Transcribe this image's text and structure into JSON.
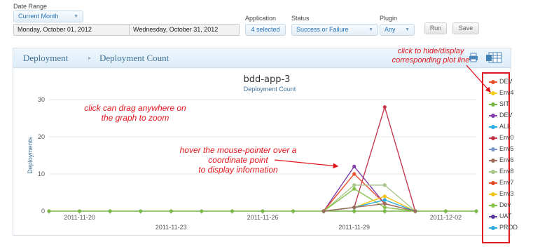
{
  "filters": {
    "date_range_label": "Date Range",
    "date_range_value": "Current Month",
    "start_date": "Monday, October 01, 2012",
    "end_date": "Wednesday, October 31, 2012",
    "application_label": "Application",
    "application_value": "4 selected",
    "status_label": "Status",
    "status_value": "Success or Failure",
    "plugin_label": "Plugin",
    "plugin_value": "Any",
    "run_label": "Run",
    "save_label": "Save"
  },
  "panel": {
    "breadcrumb_1": "Deployment",
    "breadcrumb_sep": "▸",
    "breadcrumb_2": "Deployment Count"
  },
  "annotations": {
    "legend_hint_1": "click to hide/display",
    "legend_hint_2": "corresponding plot line",
    "zoom_hint_1": "click can drag anywhere on",
    "zoom_hint_2": "the graph to zoom",
    "hover_hint_1": "hover the mouse-pointer over a",
    "hover_hint_2": "coordinate point",
    "hover_hint_3": "to display information"
  },
  "legend": [
    {
      "name": "DEV",
      "color": "#e8502f"
    },
    {
      "name": "Env4",
      "color": "#f4cf1a"
    },
    {
      "name": "SIT",
      "color": "#7ab648"
    },
    {
      "name": "DEV",
      "color": "#7f3fa8"
    },
    {
      "name": "ALL",
      "color": "#2eaee2"
    },
    {
      "name": "Env0",
      "color": "#c23a4e"
    },
    {
      "name": "Env5",
      "color": "#7d97c8"
    },
    {
      "name": "Env6",
      "color": "#9c6f5c"
    },
    {
      "name": "Env8",
      "color": "#a7c58a"
    },
    {
      "name": "Env7",
      "color": "#e14b26"
    },
    {
      "name": "Env3",
      "color": "#f2c21d"
    },
    {
      "name": "Dev",
      "color": "#85c24a"
    },
    {
      "name": "UAT",
      "color": "#5a3a9e"
    },
    {
      "name": "PROD",
      "color": "#33a9dd"
    }
  ],
  "chart_data": {
    "type": "line",
    "title": "bdd-app-3",
    "subtitle": "Deployment Count",
    "ylabel": "Deployments",
    "xlabel": "",
    "ylim": [
      0,
      30
    ],
    "yticks": [
      0,
      10,
      20,
      30
    ],
    "xticks_upper": [
      "2011-11-20",
      "2011-11-26",
      "2011-12-02"
    ],
    "xticks_lower": [
      "2011-11-23",
      "2011-11-29"
    ],
    "x": [
      "2011-11-19",
      "2011-11-20",
      "2011-11-21",
      "2011-11-22",
      "2011-11-23",
      "2011-11-24",
      "2011-11-25",
      "2011-11-26",
      "2011-11-27",
      "2011-11-28",
      "2011-11-29",
      "2011-11-30",
      "2011-12-01",
      "2011-12-02",
      "2011-12-03"
    ],
    "series": [
      {
        "name": "SIT",
        "color": "#7ab648",
        "values": [
          0,
          0,
          0,
          0,
          0,
          0,
          0,
          0,
          0,
          0,
          0,
          0,
          0,
          0,
          0
        ]
      },
      {
        "name": "Env0",
        "color": "#c23a4e",
        "values": [
          null,
          null,
          null,
          null,
          null,
          null,
          null,
          null,
          null,
          0,
          1,
          28,
          0,
          null,
          null
        ]
      },
      {
        "name": "DEV",
        "color": "#7f3fa8",
        "values": [
          null,
          null,
          null,
          null,
          null,
          null,
          null,
          null,
          null,
          0,
          12,
          2,
          0,
          null,
          null
        ]
      },
      {
        "name": "DEV",
        "color": "#e8502f",
        "values": [
          null,
          null,
          null,
          null,
          null,
          null,
          null,
          null,
          null,
          0,
          10,
          2,
          0,
          null,
          null
        ]
      },
      {
        "name": "Env8",
        "color": "#a7c58a",
        "values": [
          null,
          null,
          null,
          null,
          null,
          null,
          null,
          null,
          null,
          0,
          7,
          7,
          0,
          null,
          null
        ]
      },
      {
        "name": "Dev",
        "color": "#85c24a",
        "values": [
          null,
          null,
          null,
          null,
          null,
          null,
          null,
          null,
          null,
          0,
          6,
          1,
          0,
          null,
          null
        ]
      },
      {
        "name": "Env3",
        "color": "#f2c21d",
        "values": [
          null,
          null,
          null,
          null,
          null,
          null,
          null,
          null,
          null,
          0,
          1,
          4,
          0,
          null,
          null
        ]
      },
      {
        "name": "ALL",
        "color": "#2eaee2",
        "values": [
          null,
          null,
          null,
          null,
          null,
          null,
          null,
          null,
          null,
          0,
          1,
          3,
          0,
          null,
          null
        ]
      },
      {
        "name": "Env6",
        "color": "#9c6f5c",
        "values": [
          null,
          null,
          null,
          null,
          null,
          null,
          null,
          null,
          null,
          0,
          1,
          2,
          0,
          null,
          null
        ]
      }
    ]
  }
}
